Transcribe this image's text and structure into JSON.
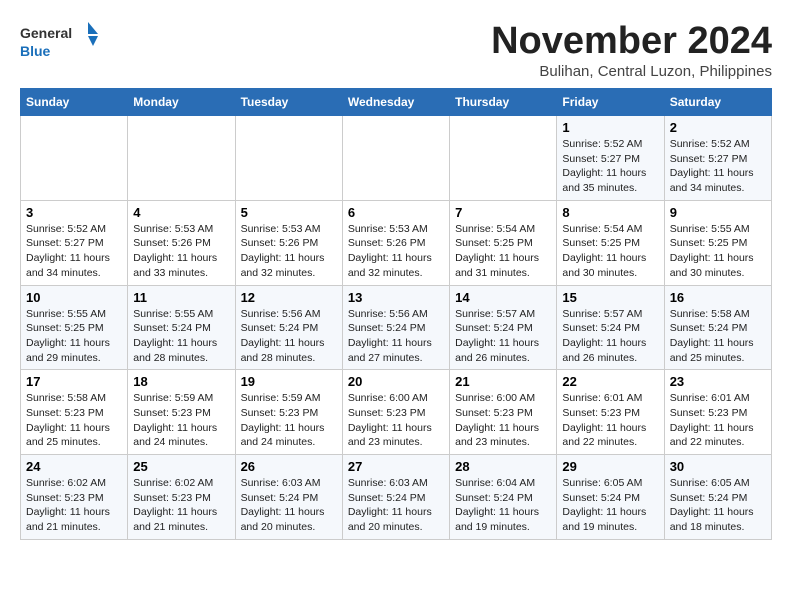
{
  "header": {
    "logo_general": "General",
    "logo_blue": "Blue",
    "month": "November 2024",
    "location": "Bulihan, Central Luzon, Philippines"
  },
  "days_of_week": [
    "Sunday",
    "Monday",
    "Tuesday",
    "Wednesday",
    "Thursday",
    "Friday",
    "Saturday"
  ],
  "weeks": [
    [
      {
        "day": "",
        "info": ""
      },
      {
        "day": "",
        "info": ""
      },
      {
        "day": "",
        "info": ""
      },
      {
        "day": "",
        "info": ""
      },
      {
        "day": "",
        "info": ""
      },
      {
        "day": "1",
        "info": "Sunrise: 5:52 AM\nSunset: 5:27 PM\nDaylight: 11 hours and 35 minutes."
      },
      {
        "day": "2",
        "info": "Sunrise: 5:52 AM\nSunset: 5:27 PM\nDaylight: 11 hours and 34 minutes."
      }
    ],
    [
      {
        "day": "3",
        "info": "Sunrise: 5:52 AM\nSunset: 5:27 PM\nDaylight: 11 hours and 34 minutes."
      },
      {
        "day": "4",
        "info": "Sunrise: 5:53 AM\nSunset: 5:26 PM\nDaylight: 11 hours and 33 minutes."
      },
      {
        "day": "5",
        "info": "Sunrise: 5:53 AM\nSunset: 5:26 PM\nDaylight: 11 hours and 32 minutes."
      },
      {
        "day": "6",
        "info": "Sunrise: 5:53 AM\nSunset: 5:26 PM\nDaylight: 11 hours and 32 minutes."
      },
      {
        "day": "7",
        "info": "Sunrise: 5:54 AM\nSunset: 5:25 PM\nDaylight: 11 hours and 31 minutes."
      },
      {
        "day": "8",
        "info": "Sunrise: 5:54 AM\nSunset: 5:25 PM\nDaylight: 11 hours and 30 minutes."
      },
      {
        "day": "9",
        "info": "Sunrise: 5:55 AM\nSunset: 5:25 PM\nDaylight: 11 hours and 30 minutes."
      }
    ],
    [
      {
        "day": "10",
        "info": "Sunrise: 5:55 AM\nSunset: 5:25 PM\nDaylight: 11 hours and 29 minutes."
      },
      {
        "day": "11",
        "info": "Sunrise: 5:55 AM\nSunset: 5:24 PM\nDaylight: 11 hours and 28 minutes."
      },
      {
        "day": "12",
        "info": "Sunrise: 5:56 AM\nSunset: 5:24 PM\nDaylight: 11 hours and 28 minutes."
      },
      {
        "day": "13",
        "info": "Sunrise: 5:56 AM\nSunset: 5:24 PM\nDaylight: 11 hours and 27 minutes."
      },
      {
        "day": "14",
        "info": "Sunrise: 5:57 AM\nSunset: 5:24 PM\nDaylight: 11 hours and 26 minutes."
      },
      {
        "day": "15",
        "info": "Sunrise: 5:57 AM\nSunset: 5:24 PM\nDaylight: 11 hours and 26 minutes."
      },
      {
        "day": "16",
        "info": "Sunrise: 5:58 AM\nSunset: 5:24 PM\nDaylight: 11 hours and 25 minutes."
      }
    ],
    [
      {
        "day": "17",
        "info": "Sunrise: 5:58 AM\nSunset: 5:23 PM\nDaylight: 11 hours and 25 minutes."
      },
      {
        "day": "18",
        "info": "Sunrise: 5:59 AM\nSunset: 5:23 PM\nDaylight: 11 hours and 24 minutes."
      },
      {
        "day": "19",
        "info": "Sunrise: 5:59 AM\nSunset: 5:23 PM\nDaylight: 11 hours and 24 minutes."
      },
      {
        "day": "20",
        "info": "Sunrise: 6:00 AM\nSunset: 5:23 PM\nDaylight: 11 hours and 23 minutes."
      },
      {
        "day": "21",
        "info": "Sunrise: 6:00 AM\nSunset: 5:23 PM\nDaylight: 11 hours and 23 minutes."
      },
      {
        "day": "22",
        "info": "Sunrise: 6:01 AM\nSunset: 5:23 PM\nDaylight: 11 hours and 22 minutes."
      },
      {
        "day": "23",
        "info": "Sunrise: 6:01 AM\nSunset: 5:23 PM\nDaylight: 11 hours and 22 minutes."
      }
    ],
    [
      {
        "day": "24",
        "info": "Sunrise: 6:02 AM\nSunset: 5:23 PM\nDaylight: 11 hours and 21 minutes."
      },
      {
        "day": "25",
        "info": "Sunrise: 6:02 AM\nSunset: 5:23 PM\nDaylight: 11 hours and 21 minutes."
      },
      {
        "day": "26",
        "info": "Sunrise: 6:03 AM\nSunset: 5:24 PM\nDaylight: 11 hours and 20 minutes."
      },
      {
        "day": "27",
        "info": "Sunrise: 6:03 AM\nSunset: 5:24 PM\nDaylight: 11 hours and 20 minutes."
      },
      {
        "day": "28",
        "info": "Sunrise: 6:04 AM\nSunset: 5:24 PM\nDaylight: 11 hours and 19 minutes."
      },
      {
        "day": "29",
        "info": "Sunrise: 6:05 AM\nSunset: 5:24 PM\nDaylight: 11 hours and 19 minutes."
      },
      {
        "day": "30",
        "info": "Sunrise: 6:05 AM\nSunset: 5:24 PM\nDaylight: 11 hours and 18 minutes."
      }
    ]
  ]
}
